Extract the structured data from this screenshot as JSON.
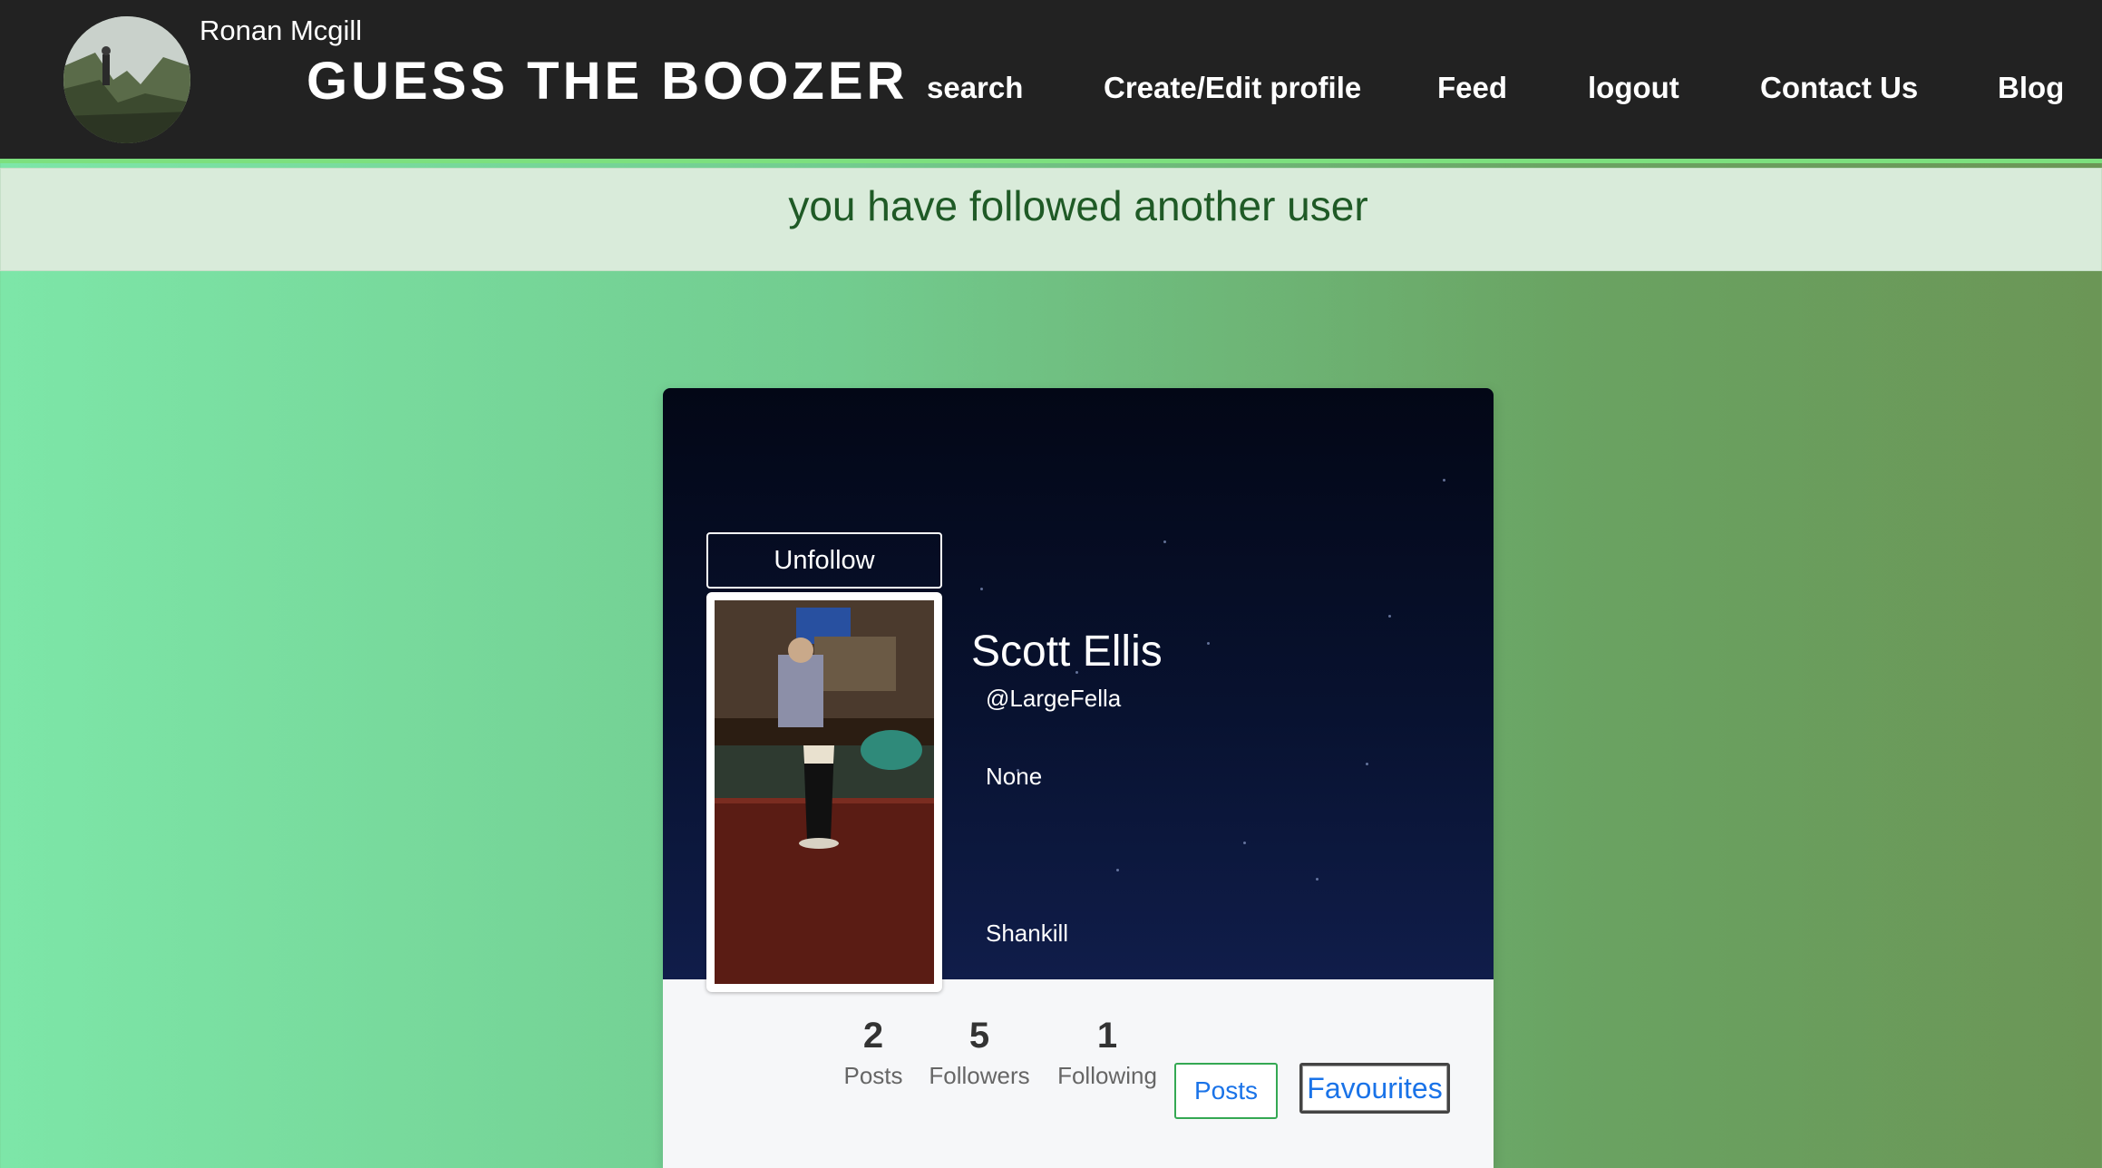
{
  "header": {
    "username": "Ronan Mcgill",
    "brand": "GUESS THE BOOZER",
    "nav": [
      {
        "label": "search"
      },
      {
        "label": "Create/Edit profile"
      },
      {
        "label": "Feed"
      },
      {
        "label": "logout"
      },
      {
        "label": "Contact Us"
      },
      {
        "label": "Blog"
      }
    ]
  },
  "flash": {
    "message": "you have followed another user"
  },
  "profile": {
    "unfollow_label": "Unfollow",
    "name": "Scott Ellis",
    "handle": "@LargeFella",
    "bio": "None",
    "location": "Shankill",
    "stats": {
      "posts": {
        "value": "2",
        "label": "Posts"
      },
      "followers": {
        "value": "5",
        "label": "Followers"
      },
      "following": {
        "value": "1",
        "label": "Following"
      }
    },
    "posts_button": "Posts",
    "favourites_button": "Favourites"
  },
  "colors": {
    "header_bg": "#222222",
    "header_accent": "#7ce07e",
    "flash_bg": "#d9ebda",
    "flash_text": "#1f5a26",
    "card_top": "#081230",
    "link_blue": "#1a73e8"
  }
}
